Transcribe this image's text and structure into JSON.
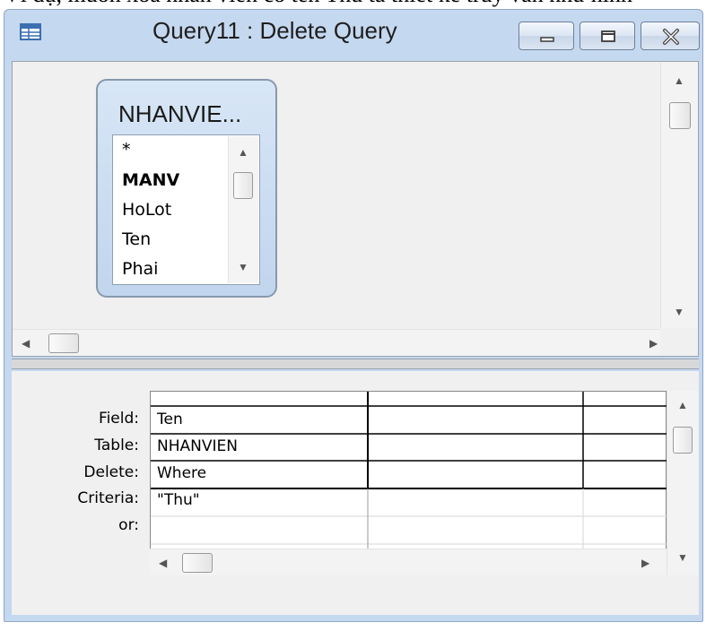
{
  "cropped_caption": "Ví dụ, muốn xóa nhân viên có tên Thu ta thiết kế truy vấn như hình",
  "window": {
    "title": "Query11 : Delete Query",
    "controls": {
      "minimize_icon": "minimize-icon",
      "maximize_icon": "maximize-icon",
      "close_icon": "close-icon"
    }
  },
  "table": {
    "title": "NHANVIE...",
    "fields": [
      "*",
      "MANV",
      "HoLot",
      "Ten",
      "Phai"
    ]
  },
  "grid": {
    "row_labels": [
      "Field:",
      "Table:",
      "Delete:",
      "Criteria:",
      "or:"
    ],
    "columns": [
      {
        "field": "Ten",
        "table": "NHANVIEN",
        "delete": "Where",
        "criteria": "\"Thu\"",
        "or": ""
      },
      {
        "field": "",
        "table": "",
        "delete": "",
        "criteria": "",
        "or": ""
      },
      {
        "field": "",
        "table": "",
        "delete": "",
        "criteria": "",
        "or": ""
      }
    ]
  }
}
